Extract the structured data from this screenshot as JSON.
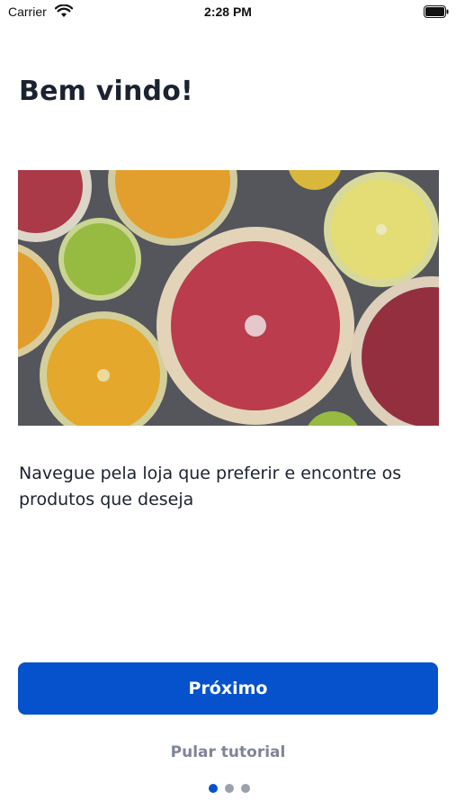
{
  "status_bar": {
    "carrier": "Carrier",
    "time": "2:28 PM",
    "wifi_icon": "wifi-icon",
    "battery_icon": "battery-icon"
  },
  "onboarding": {
    "title": "Bem vindo!",
    "image": "citrus-slices-photo",
    "description": "Navegue pela loja que preferir e encontre os produtos que deseja",
    "next_label": "Próximo",
    "skip_label": "Pular tutorial",
    "page_indicator": {
      "total": 3,
      "current": 1
    }
  },
  "colors": {
    "primary": "#0652cc",
    "title_text": "#1b2230",
    "muted_text": "#7d8597",
    "inactive_dot": "#9aa1ad"
  }
}
